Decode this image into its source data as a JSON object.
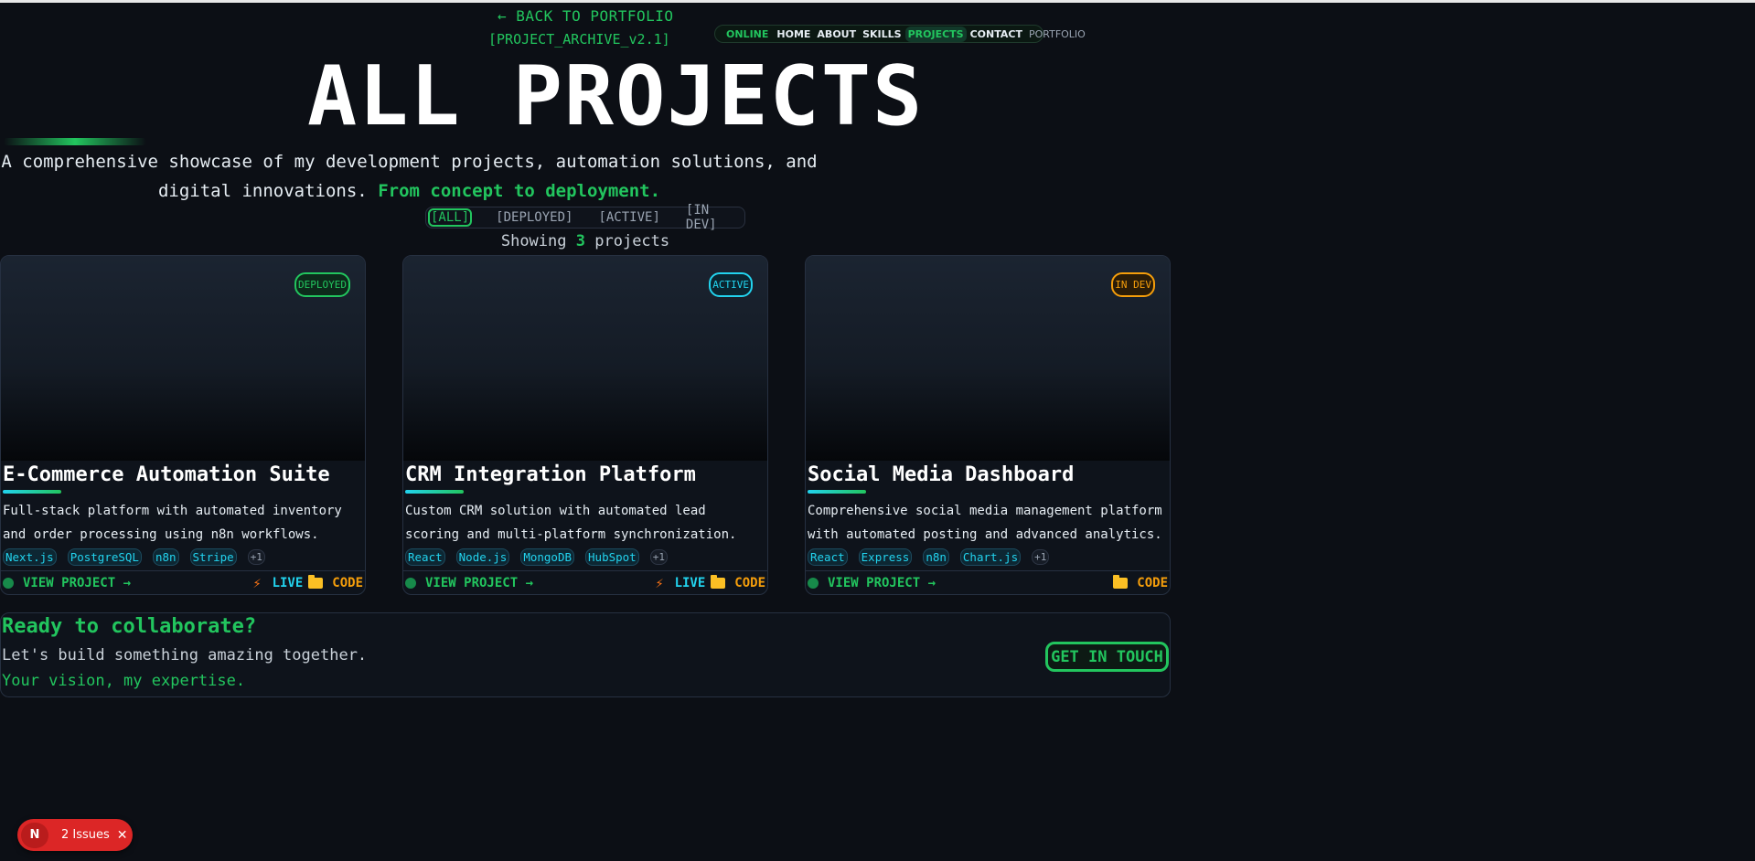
{
  "header": {
    "back_label": "← BACK TO PORTFOLIO",
    "archive_label": "[PROJECT_ARCHIVE_v2.1]"
  },
  "nav": {
    "status": "ONLINE",
    "items": [
      "HOME",
      "ABOUT",
      "SKILLS",
      "PROJECTS",
      "CONTACT",
      "PORTFOLIO"
    ],
    "active": "PROJECTS"
  },
  "hero": {
    "title": "ALL PROJECTS",
    "subtitle": "A comprehensive showcase of my development projects, automation solutions, and digital innovations.",
    "subtitle_accent": "From concept to deployment."
  },
  "filters": {
    "items": [
      "[ALL]",
      "[DEPLOYED]",
      "[ACTIVE]",
      "[IN DEV]"
    ],
    "active": "[ALL]"
  },
  "showing": {
    "prefix": "Showing",
    "count": "3",
    "suffix": "projects"
  },
  "projects": [
    {
      "status": "DEPLOYED",
      "title": "E-Commerce Automation Suite",
      "description": "Full-stack platform with automated inventory and order processing using n8n workflows.",
      "tags": [
        "Next.js",
        "PostgreSQL",
        "n8n",
        "Stripe"
      ],
      "more": "+1",
      "view_label": "VIEW PROJECT →",
      "live_label": "LIVE",
      "code_label": "CODE"
    },
    {
      "status": "ACTIVE",
      "title": "CRM Integration Platform",
      "description": "Custom CRM solution with automated lead scoring and multi-platform synchronization.",
      "tags": [
        "React",
        "Node.js",
        "MongoDB",
        "HubSpot"
      ],
      "more": "+1",
      "view_label": "VIEW PROJECT →",
      "live_label": "LIVE",
      "code_label": "CODE"
    },
    {
      "status": "IN DEV",
      "title": "Social Media Dashboard",
      "description": "Comprehensive social media management platform with automated posting and advanced analytics.",
      "tags": [
        "React",
        "Express",
        "n8n",
        "Chart.js"
      ],
      "more": "+1",
      "view_label": "VIEW PROJECT →",
      "code_label": "CODE"
    }
  ],
  "cta": {
    "title": "Ready to collaborate?",
    "subtitle": "Let's build something amazing together.",
    "tagline": "Your vision, my expertise.",
    "button": "GET IN TOUCH"
  },
  "dev_overlay": {
    "logo": "N",
    "label": "2 Issues",
    "close": "✕"
  },
  "colors": {
    "background": "#0c0f15",
    "accent_green": "#22c55e",
    "accent_cyan": "#22d3ee",
    "accent_orange": "#f59e0b",
    "issues_red": "#dc2626"
  }
}
